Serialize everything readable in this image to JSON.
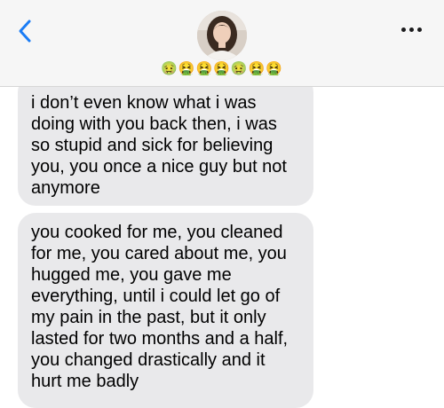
{
  "header": {
    "contact_name": "🤢🤮🤮🤮🤢🤮🤮",
    "back_icon": "chevron-left",
    "more_icon": "ellipsis",
    "accent_color": "#1a7cf5"
  },
  "messages": [
    {
      "direction": "received",
      "lines": [
        "i don’t even know what i was",
        "doing with you back then, i was",
        "so stupid and sick for believing",
        "you, you once a nice guy but not",
        "anymore"
      ]
    },
    {
      "direction": "received",
      "lines": [
        "you cooked for me, you cleaned",
        "for me, you cared about me, you",
        "hugged me, you gave me",
        "everything, until i could let go of",
        "my pain in the past, but it only",
        "lasted for two months and a half,",
        "you changed drastically and it",
        "hurt me badly"
      ]
    }
  ]
}
